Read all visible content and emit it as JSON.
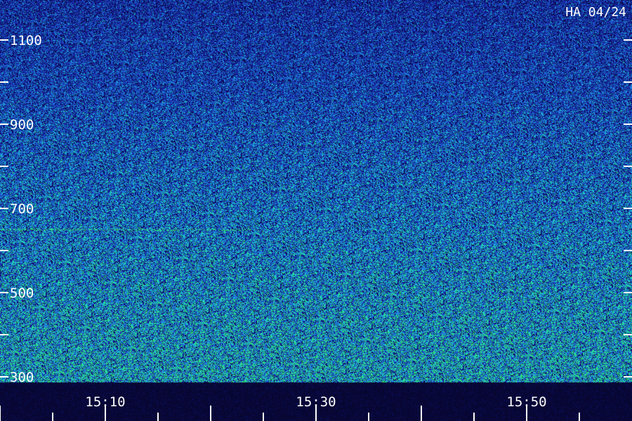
{
  "chart_data": {
    "type": "heatmap",
    "title": "",
    "xlabel": "",
    "ylabel": "",
    "stamp": "HA 04/24",
    "x_tick_labels": [
      "15:10",
      "15:30",
      "15:50"
    ],
    "x_range_minutes": [
      15,
      75
    ],
    "x_label_minutes": [
      30,
      50,
      70
    ],
    "x_tick_minutes_step": 5,
    "y_tick_labels": [
      "300",
      "500",
      "700",
      "900",
      "1100"
    ],
    "y_tick_values": [
      300,
      500,
      700,
      900,
      1100
    ],
    "y_minor_values": [
      400,
      600,
      800,
      1000,
      1200
    ],
    "y_range": [
      300,
      1170
    ],
    "colormap": [
      "#0a0a55",
      "#1a2fb0",
      "#1e7fe0",
      "#20d0c8",
      "#30e070"
    ],
    "background_color": "#050530",
    "features": [
      {
        "description_freq": 650,
        "x_start_minutes": 20,
        "x_end_minutes": 44,
        "level": "bright"
      },
      {
        "description_freq": 1100,
        "x_start_minutes": 20,
        "x_end_minutes": 40,
        "level": "faint"
      }
    ],
    "intensity_trend": "stronger at low frequencies, weaker at high frequencies"
  }
}
